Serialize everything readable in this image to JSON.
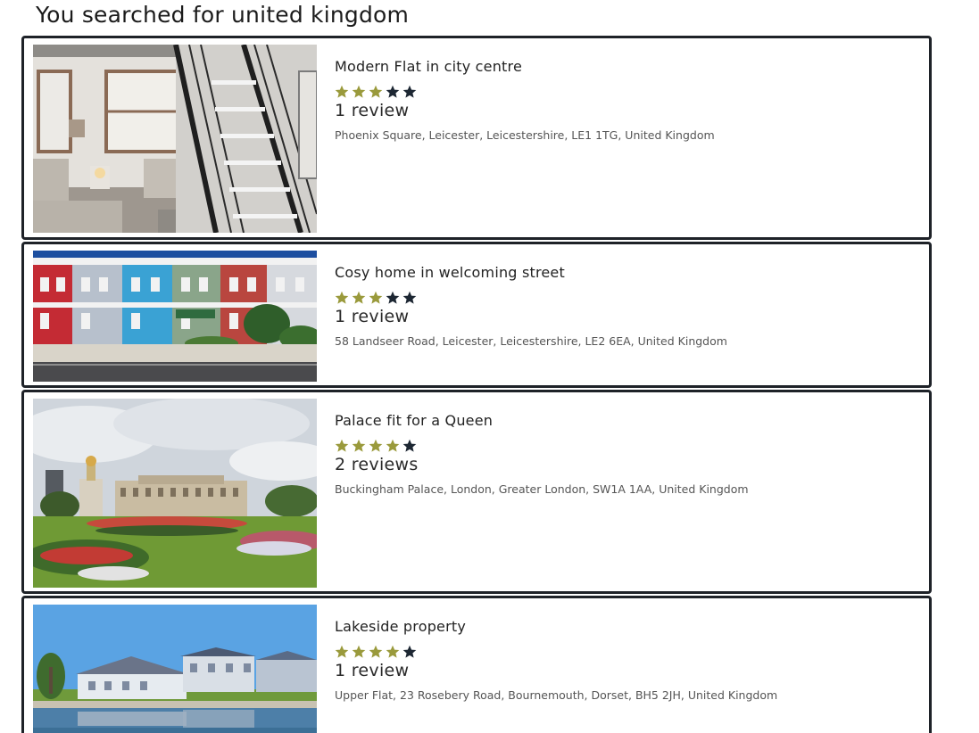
{
  "search": {
    "heading": "You searched for united kingdom"
  },
  "colors": {
    "star_filled": "#9a9a3c",
    "star_empty": "#1d2733",
    "card_border": "#1e2228"
  },
  "results": [
    {
      "title": "Modern Flat in city centre",
      "rating": 3,
      "rating_max": 5,
      "reviews": "1 review",
      "address": "Phoenix Square, Leicester, Leicestershire, LE1 1TG, United Kingdom",
      "image": "interior-with-staircase-photo"
    },
    {
      "title": "Cosy home in welcoming street",
      "rating": 3,
      "rating_max": 5,
      "reviews": "1 review",
      "address": "58 Landseer Road, Leicester, Leicestershire, LE2 6EA, United Kingdom",
      "image": "colorful-terraced-houses-photo"
    },
    {
      "title": "Palace fit for a Queen",
      "rating": 4,
      "rating_max": 5,
      "reviews": "2 reviews",
      "address": "Buckingham Palace, London, Greater London, SW1A 1AA, United Kingdom",
      "image": "palace-with-gardens-photo"
    },
    {
      "title": "Lakeside property",
      "rating": 4,
      "rating_max": 5,
      "reviews": "1 review",
      "address": "Upper Flat, 23 Rosebery Road, Bournemouth, Dorset, BH5 2JH, United Kingdom",
      "image": "lakeside-houses-photo"
    }
  ]
}
